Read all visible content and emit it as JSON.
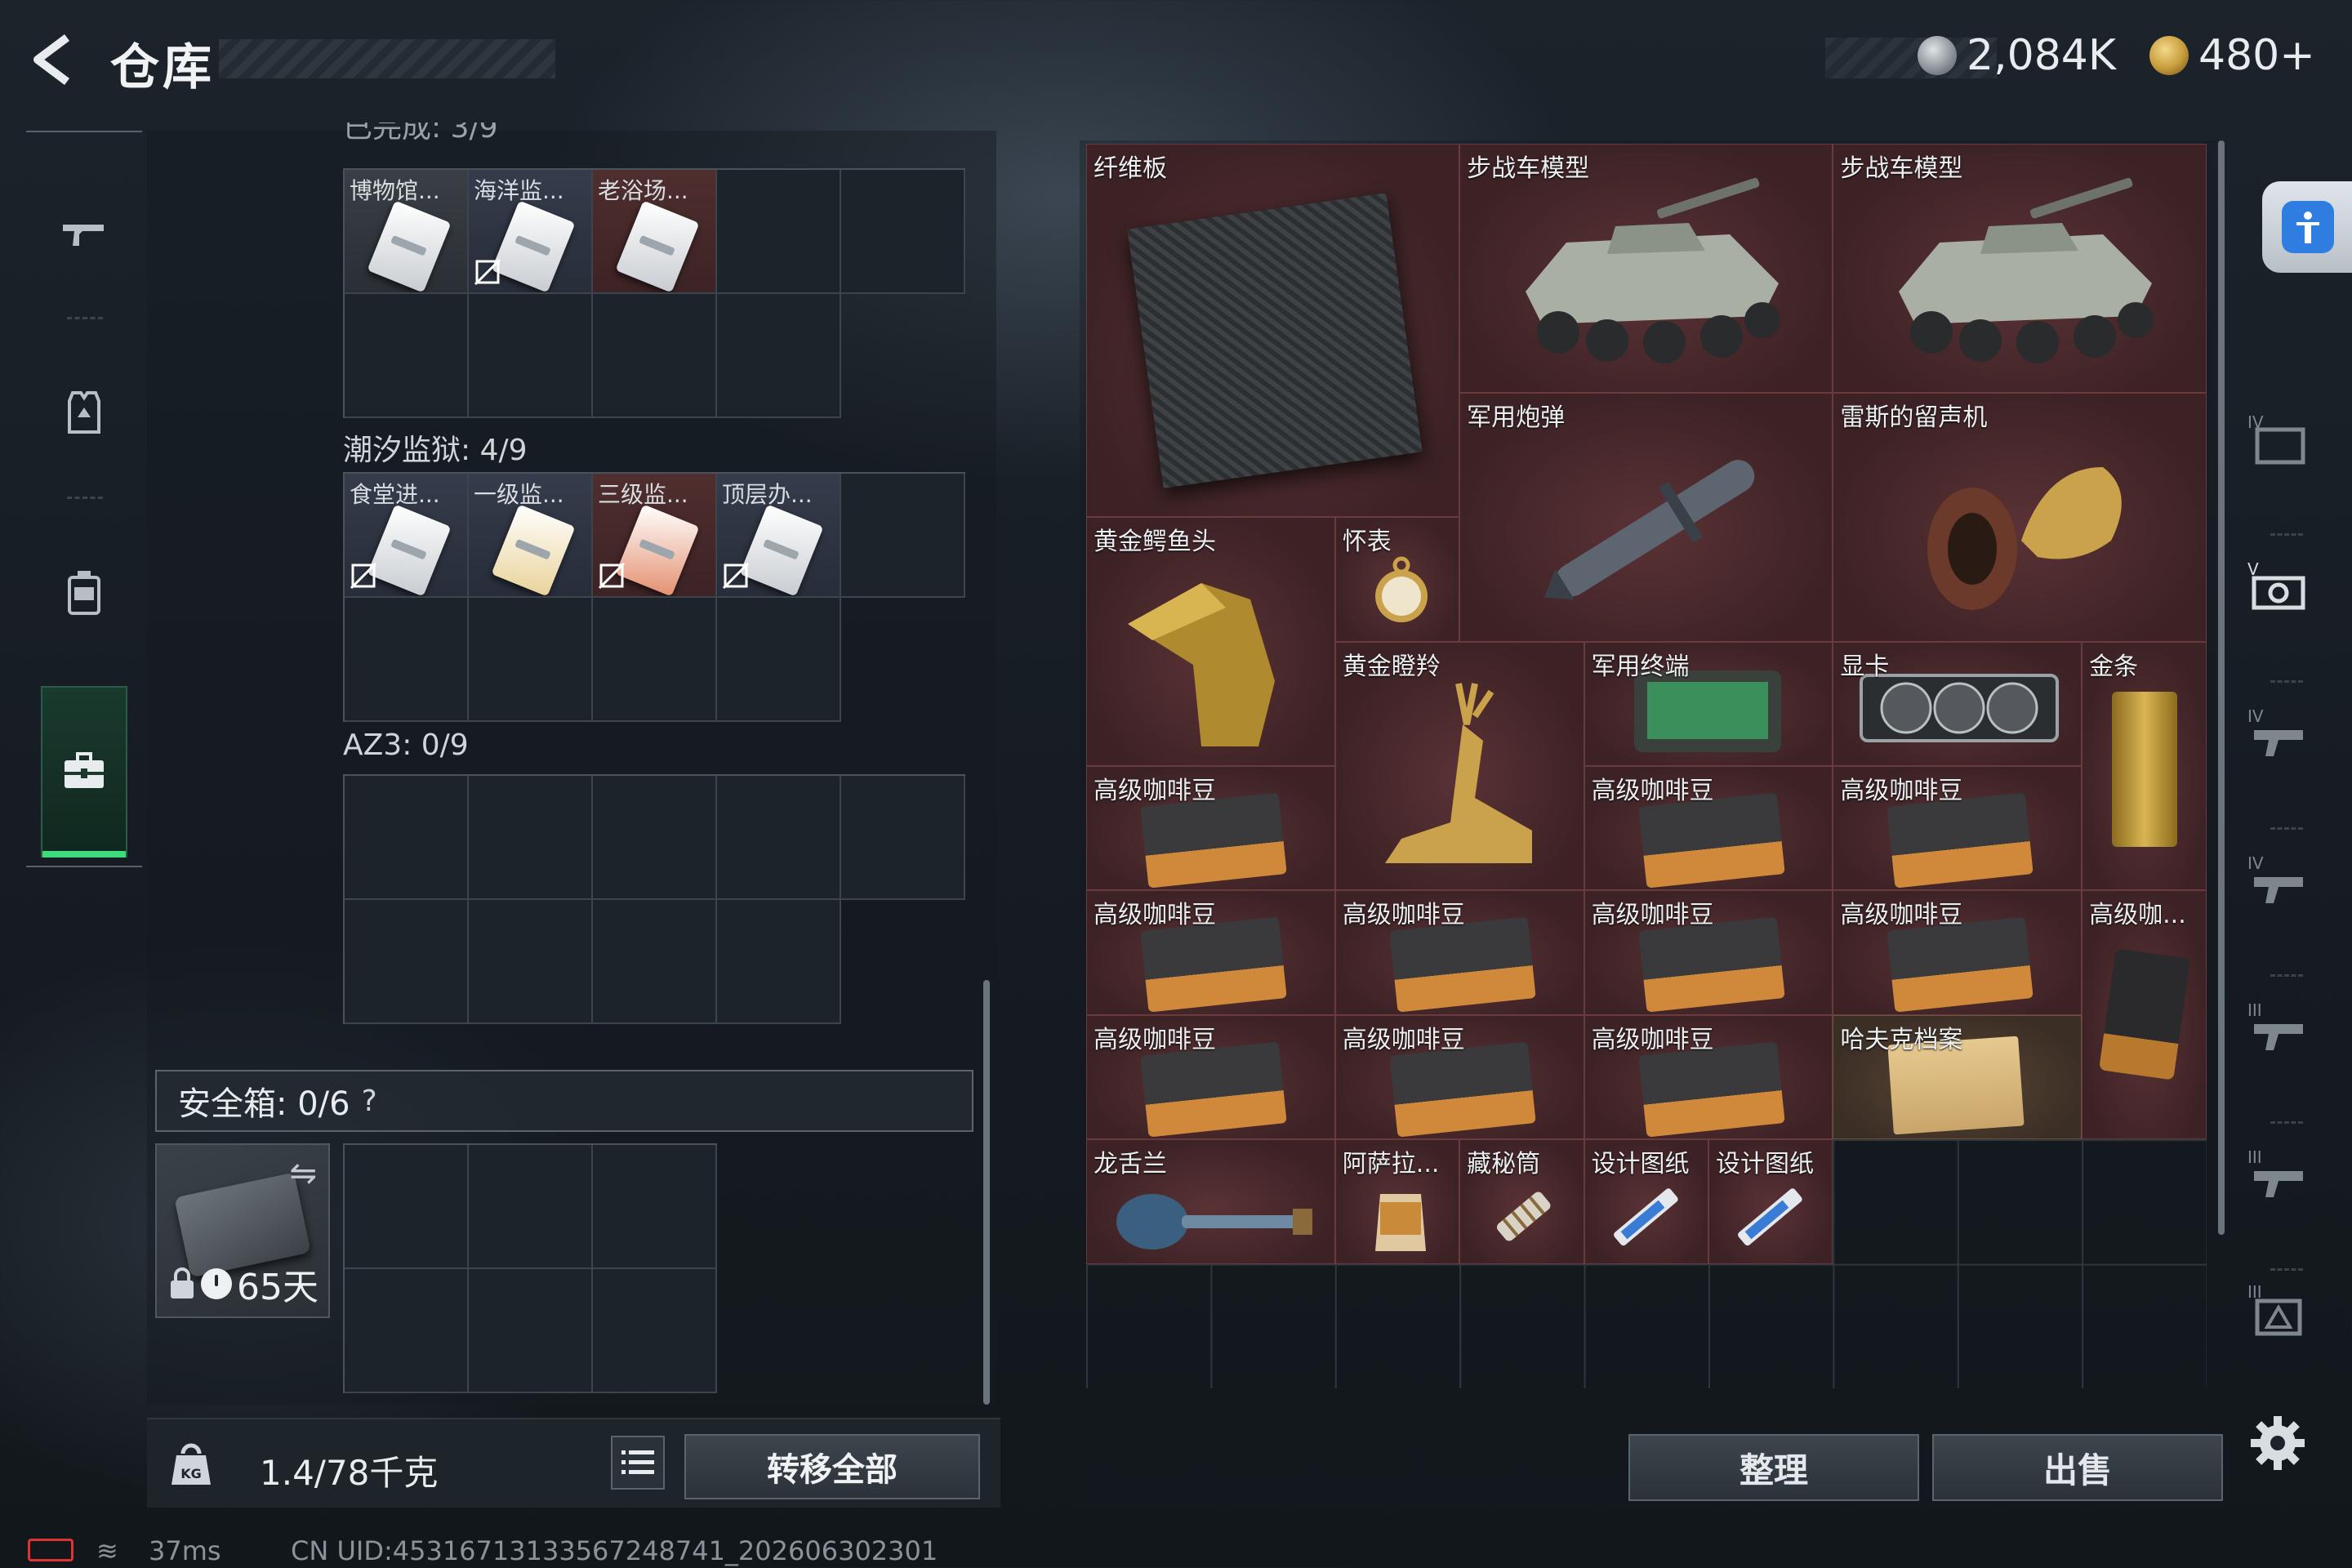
{
  "header": {
    "title": "仓库",
    "currency_1": "2,084K",
    "currency_2": "480+",
    "currency_1_icon": "silver-coin-icon",
    "currency_2_icon": "gold-triangle-coin-icon"
  },
  "nav": {
    "items": [
      "weapon-icon",
      "armor-vest-icon",
      "backpack-icon",
      "briefcase-icon"
    ],
    "active_index": 3
  },
  "stash": {
    "sections": [
      {
        "name_partial": "已完成: 3/9",
        "keys": [
          {
            "name": "博物馆...",
            "quality": "white",
            "no_drop": false
          },
          {
            "name": "海洋监...",
            "quality": "blue",
            "no_drop": true
          },
          {
            "name": "老浴场...",
            "quality": "red",
            "no_drop": false
          }
        ]
      },
      {
        "name": "潮汐监狱: 4/9",
        "keys": [
          {
            "name": "食堂进...",
            "quality": "blue",
            "no_drop": true
          },
          {
            "name": "一级监...",
            "quality": "blue",
            "no_drop": false
          },
          {
            "name": "三级监...",
            "quality": "red",
            "no_drop": true
          },
          {
            "name": "顶层办...",
            "quality": "blue",
            "no_drop": true
          }
        ]
      },
      {
        "name": "AZ3: 0/9",
        "keys": []
      }
    ],
    "safe_box": {
      "label": "安全箱: 0/6",
      "help": "?",
      "days": "65天"
    },
    "weight": "1.4/78千克",
    "transfer_all": "转移全部"
  },
  "inventory": {
    "items": [
      {
        "name": "纤维板",
        "art": "carbon-plate",
        "quality": "red"
      },
      {
        "name": "步战车模型",
        "art": "ifv",
        "quality": "red"
      },
      {
        "name": "步战车模型",
        "art": "ifv",
        "quality": "red"
      },
      {
        "name": "军用炮弹",
        "art": "shell",
        "quality": "red"
      },
      {
        "name": "雷斯的留声机",
        "art": "phonograph",
        "quality": "red"
      },
      {
        "name": "黄金鳄鱼头",
        "art": "croc",
        "quality": "red"
      },
      {
        "name": "怀表",
        "art": "watch",
        "quality": "red"
      },
      {
        "name": "黄金瞪羚",
        "art": "gazelle",
        "quality": "red"
      },
      {
        "name": "军用终端",
        "art": "terminal",
        "quality": "red"
      },
      {
        "name": "显卡",
        "art": "gpu",
        "quality": "red"
      },
      {
        "name": "金条",
        "art": "goldbar",
        "quality": "red"
      },
      {
        "name": "高级咖啡豆",
        "art": "coffee",
        "quality": "red"
      },
      {
        "name": "高级咖啡豆",
        "art": "coffee",
        "quality": "red"
      },
      {
        "name": "高级咖啡豆",
        "art": "coffee",
        "quality": "red"
      },
      {
        "name": "高级咖啡豆",
        "art": "coffee",
        "quality": "red"
      },
      {
        "name": "高级咖啡豆",
        "art": "coffee",
        "quality": "red"
      },
      {
        "name": "高级咖啡豆",
        "art": "coffee",
        "quality": "red"
      },
      {
        "name": "高级咖啡豆",
        "art": "coffee",
        "quality": "red"
      },
      {
        "name": "高级咖...",
        "art": "coffee-bag",
        "quality": "red"
      },
      {
        "name": "高级咖啡豆",
        "art": "coffee",
        "quality": "red"
      },
      {
        "name": "高级咖啡豆",
        "art": "coffee",
        "quality": "red"
      },
      {
        "name": "高级咖啡豆",
        "art": "coffee",
        "quality": "red"
      },
      {
        "name": "哈夫克档案",
        "art": "file",
        "quality": "brown"
      },
      {
        "name": "龙舌兰",
        "art": "tequila",
        "quality": "red"
      },
      {
        "name": "阿萨拉...",
        "art": "teapot",
        "quality": "red"
      },
      {
        "name": "藏秘筒",
        "art": "cryptex",
        "quality": "red"
      },
      {
        "name": "设计图纸",
        "art": "blueprint",
        "quality": "red"
      },
      {
        "name": "设计图纸",
        "art": "blueprint",
        "quality": "red"
      }
    ],
    "sort": "整理",
    "sell": "出售"
  },
  "filters": [
    "accessibility-icon",
    "tier-4-box-icon",
    "tier-5-camera-icon",
    "tier-4-gun-icon",
    "tier-4-gun-icon",
    "tier-3-gun-icon",
    "tier-3-gun-icon",
    "tier-3-helmet-icon"
  ],
  "status": {
    "ping": "37ms",
    "uid": "CN UID:4531671313356724874​1_202606302301"
  },
  "colors": {
    "accent_green": "#3ddc7a",
    "quality_red": "#5a3235",
    "accessibility_blue": "#2f7de1"
  }
}
